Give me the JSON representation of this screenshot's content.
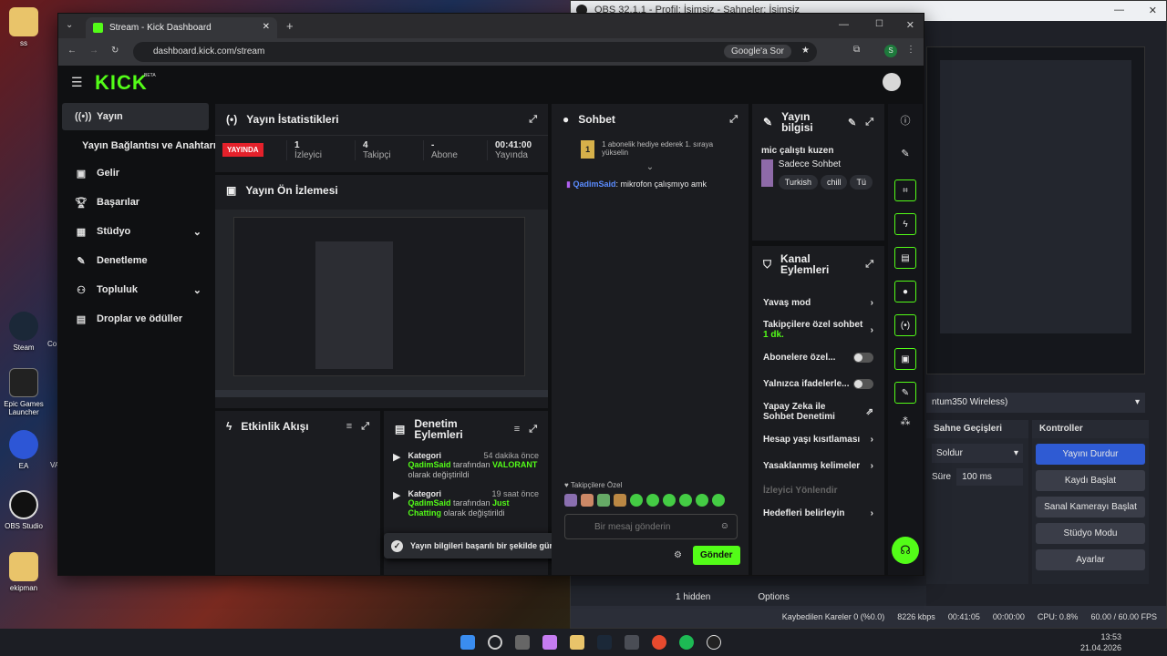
{
  "desktop": {
    "top_icon_label": "ss",
    "icons": [
      {
        "label": "Steam"
      },
      {
        "label": "Epic Games Launcher"
      },
      {
        "label": "EA"
      },
      {
        "label": "OBS Studio"
      },
      {
        "label": "ekipman"
      }
    ],
    "partial_labels": [
      "Co",
      "VA"
    ]
  },
  "obs": {
    "title": "OBS 32.1.1 - Profil: İsimsiz - Sahneler: İsimsiz",
    "device_label": "ntum350 Wireless)",
    "transitions_title": "Sahne Geçişleri",
    "transition_select": "Soldur",
    "duration_label": "Süre",
    "duration_value": "100 ms",
    "controls_title": "Kontroller",
    "controls": [
      "Yayını Durdur",
      "Kaydı Başlat",
      "Sanal Kamerayı Başlat",
      "Stüdyo Modu",
      "Ayarlar"
    ],
    "bottom_bar": {
      "hidden": "1 hidden",
      "options": "Options"
    },
    "status": {
      "dropped": "Kaybedilen Kareler 0 (%0.0)",
      "kbps": "8226 kbps",
      "stream_time": "00:41:05",
      "rec_time": "00:00:00",
      "cpu": "CPU: 0.8%",
      "fps": "60.00 / 60.00 FPS"
    }
  },
  "browser": {
    "tab_title": "Stream - Kick Dashboard",
    "url": "dashboard.kick.com/stream",
    "google_btn": "Google'a Sor",
    "profile_letter": "S"
  },
  "kick": {
    "logo": "KICK",
    "logo_badge": "BETA",
    "sidebar": [
      {
        "label": "Yayın",
        "icon": "broadcast-icon"
      },
      {
        "label": "Yayın Bağlantısı ve Anahtarı",
        "icon": ""
      },
      {
        "label": "Gelir",
        "icon": "wallet-icon"
      },
      {
        "label": "Başarılar",
        "icon": "trophy-icon"
      },
      {
        "label": "Stüdyo",
        "icon": "grid-icon"
      },
      {
        "label": "Denetleme",
        "icon": "wrench-icon"
      },
      {
        "label": "Topluluk",
        "icon": "people-icon"
      },
      {
        "label": "Droplar ve ödüller",
        "icon": "gift-icon"
      }
    ],
    "stats": {
      "title": "Yayın İstatistikleri",
      "live_badge": "YAYINDA",
      "items": [
        {
          "value": "1",
          "label": "İzleyici"
        },
        {
          "value": "4",
          "label": "Takipçi"
        },
        {
          "value": "-",
          "label": "Abone"
        },
        {
          "value": "00:41:00",
          "label": "Yayında"
        }
      ]
    },
    "preview": {
      "title": "Yayın Ön İzlemesi"
    },
    "activity": {
      "title": "Etkinlik Akışı"
    },
    "moderation": {
      "title": "Denetim Eylemleri",
      "items": [
        {
          "title": "Kategori",
          "time": "54 dakika önce",
          "user": "QadimSaid",
          "middle": " tarafından ",
          "value": "VALORANT",
          "suffix": " olarak değiştirildi"
        },
        {
          "title": "Kategori",
          "time": "19 saat önce",
          "user": "QadimSaid",
          "middle": " tarafından ",
          "value": "Just Chatting",
          "suffix": " olarak değiştirildi"
        }
      ],
      "trailing": "olarak değiştirildi"
    },
    "chat": {
      "title": "Sohbet",
      "pinned_count": "1",
      "pinned_text": "1 abonelik hediye ederek 1. sıraya yükselin",
      "message_user": "QadimSaid",
      "message_text": ": mikrofon çalışmıyo amk",
      "emote_label": "Takipçilere Özel",
      "input_placeholder": "Bir mesaj gönderin",
      "send": "Gönder"
    },
    "info": {
      "title": "Yayın bilgisi",
      "stream_title": "mic çalıştı kuzen",
      "category": "Sadece Sohbet",
      "tags": [
        "Turkish",
        "chill",
        "Tü"
      ]
    },
    "channel_actions": {
      "title": "Kanal Eylemleri",
      "items": [
        {
          "label": "Yavaş mod",
          "type": "arrow"
        },
        {
          "label": "Takipçilere özel sohbet",
          "sub": "1 dk.",
          "type": "arrow"
        },
        {
          "label": "Abonelere özel...",
          "type": "toggle"
        },
        {
          "label": "Yalnızca ifadelerle...",
          "type": "toggle"
        },
        {
          "label": "Yapay Zeka ile Sohbet Denetimi",
          "type": "external"
        },
        {
          "label": "Hesap yaşı kısıtlaması",
          "type": "arrow"
        },
        {
          "label": "Yasaklanmış kelimeler",
          "type": "arrow"
        },
        {
          "label": "İzleyici Yönlendir",
          "type": "disabled"
        },
        {
          "label": "Hedefleri belirleyin",
          "type": "arrow"
        }
      ]
    },
    "toast": "Yayın bilgileri başarılı bir şekilde güncellendi."
  },
  "taskbar": {
    "time": "13:53",
    "date": "21.04.2026"
  },
  "colors": {
    "accent": "#53fc18",
    "live": "#e5212b",
    "obs_blue": "#2f5bd3"
  }
}
